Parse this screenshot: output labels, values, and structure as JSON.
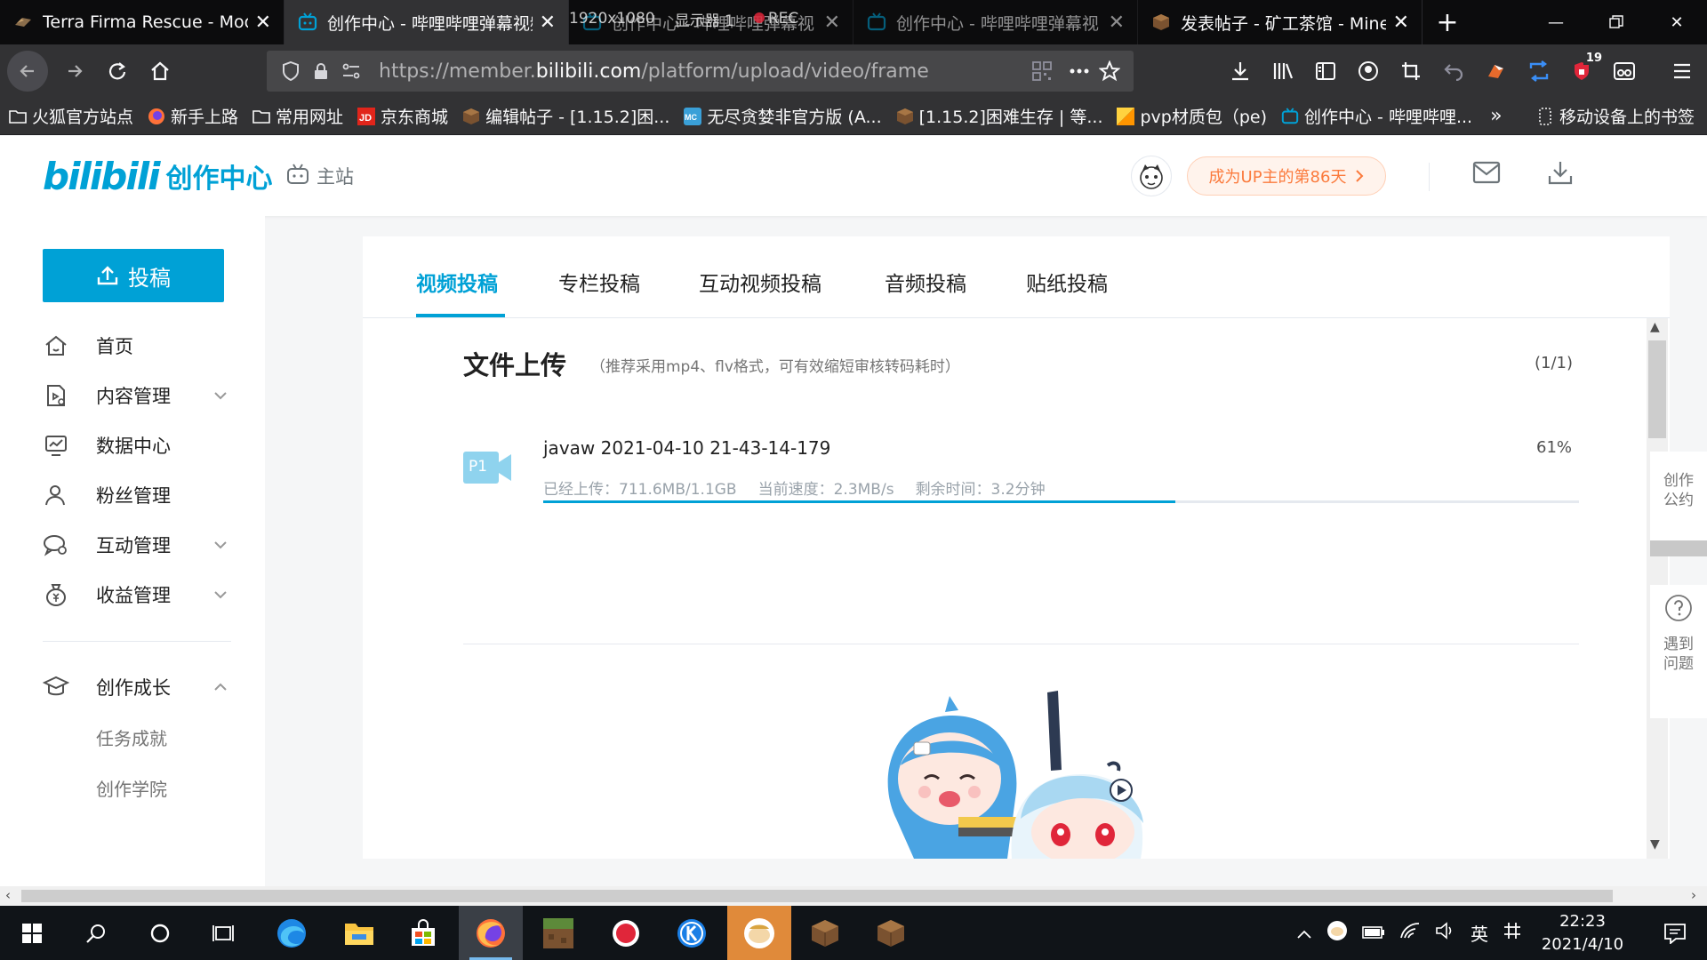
{
  "browser": {
    "tabs": [
      {
        "title": "Terra Firma Rescue - Modp",
        "active": false
      },
      {
        "title": "创作中心 - 哔哩哔哩弹幕视频",
        "active": true
      },
      {
        "title": "创作中心 - 哔哩哔哩弹幕视",
        "active": false
      },
      {
        "title": "创作中心 - 哔哩哔哩弹幕视",
        "active": false
      },
      {
        "title": "发表帖子 - 矿工茶馆 - Minec",
        "active": false
      }
    ],
    "recording_overlay": {
      "resolution": "1920x1080",
      "display": "显示器 1",
      "rec": "REC"
    },
    "url": {
      "prefix": "https://member.",
      "domain": "bilibili.com",
      "path": "/platform/upload/video/frame"
    },
    "addon_badge": "19",
    "bookmarks": [
      "火狐官方站点",
      "新手上路",
      "常用网址",
      "京东商城",
      "编辑帖子 - [1.15.2]困...",
      "无尽贪婪非官方版 (A...",
      "[1.15.2]困难生存 | 等...",
      "pvp材质包（pe)",
      "创作中心 - 哔哩哔哩..."
    ],
    "bookmarks_mobile": "移动设备上的书签"
  },
  "header": {
    "logo_text": "bilibili",
    "logo_sub": "创作中心",
    "main_site": "主站",
    "up_pill": "成为UP主的第86天"
  },
  "sidebar": {
    "upload_label": "投稿",
    "items": [
      {
        "label": "首页"
      },
      {
        "label": "内容管理"
      },
      {
        "label": "数据中心"
      },
      {
        "label": "粉丝管理"
      },
      {
        "label": "互动管理"
      },
      {
        "label": "收益管理"
      },
      {
        "label": "创作成长"
      }
    ],
    "sub_items": [
      "任务成就",
      "创作学院"
    ]
  },
  "main": {
    "tabs": [
      "视频投稿",
      "专栏投稿",
      "互动视频投稿",
      "音频投稿",
      "贴纸投稿"
    ],
    "file_upload": {
      "title": "文件上传",
      "hint": "（推荐采用mp4、flv格式，可有效缩短审核转码耗时）",
      "count": "(1/1)"
    },
    "file": {
      "badge": "P1",
      "name": "javaw 2021-04-10 21-43-14-179",
      "percent_label": "61%",
      "progress": 0.61,
      "uploaded": "已经上传：711.6MB/1.1GB",
      "speed": "当前速度：2.3MB/s",
      "remaining": "剩余时间：3.2分钟"
    }
  },
  "float_panel": {
    "convention": "创作公约",
    "help": "遇到问题"
  },
  "taskbar": {
    "time": "22:23",
    "date": "2021/4/10",
    "ime": "英"
  },
  "colors": {
    "accent": "#00a1d6",
    "pill_text": "#fb7a3c",
    "pill_bg": "#fff3ec"
  }
}
